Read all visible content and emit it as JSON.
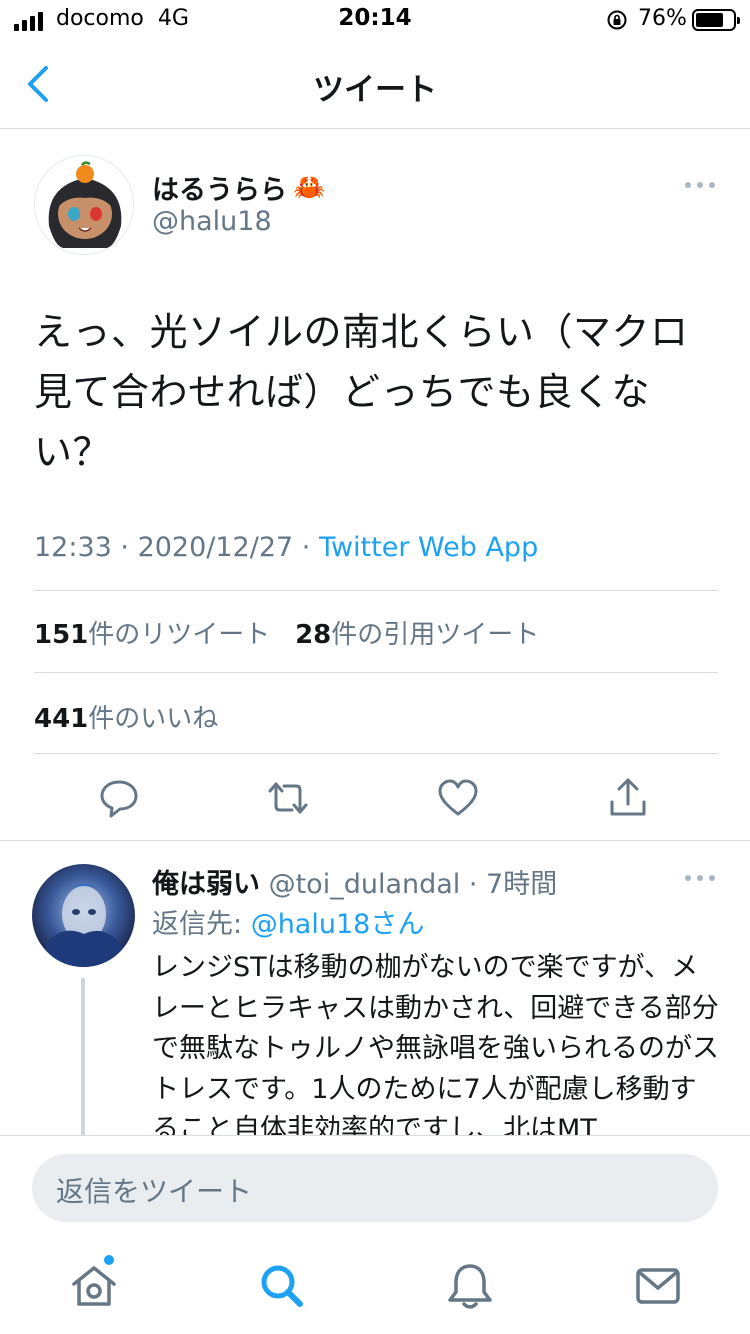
{
  "status_bar": {
    "carrier": "docomo",
    "network": "4G",
    "time": "20:14",
    "battery_percent": "76%",
    "battery_level": 0.76
  },
  "nav": {
    "title": "ツイート",
    "back_icon": "chevron-left-icon"
  },
  "tweet": {
    "display_name": "はるうらら",
    "name_emoji": "🦀",
    "handle": "@halu18",
    "text": "えっ、光ソイルの南北くらい（マクロ見て合わせれば）どっちでも良くない？",
    "time": "12:33",
    "sep1": " · ",
    "date": "2020/12/27",
    "sep2": " · ",
    "source": "Twitter Web App",
    "retweet_count": "151",
    "retweet_label": "件のリツイート",
    "quote_count": "28",
    "quote_label": "件の引用ツイート",
    "like_count": "441",
    "like_label": "件のいいね"
  },
  "reply": {
    "display_name": "俺は弱い",
    "handle": "@toi_dulandal",
    "sep": " · ",
    "age": "7時間",
    "reply_to_label": "返信先: ",
    "reply_to_mention": "@halu18さん",
    "text": "レンジSTは移動の枷がないので楽ですが、メレーとヒラキャスは動かされ、回避できる部分で無駄なトゥルノや無詠唱を強いられるのがストレスです。1人のために7人が配慮し移動すること自体非効率的ですし、北はMT"
  },
  "composer": {
    "placeholder": "返信をツイート"
  },
  "colors": {
    "accent": "#1da1f2",
    "secondary_text": "#657786",
    "primary_text": "#14171a",
    "divider": "#d8dde0"
  },
  "icons": {
    "actions": [
      "reply-icon",
      "retweet-icon",
      "like-icon",
      "share-icon"
    ],
    "tabs": [
      "home-icon",
      "search-icon",
      "notifications-icon",
      "messages-icon"
    ]
  }
}
